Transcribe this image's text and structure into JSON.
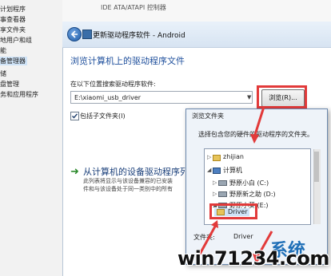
{
  "left_panel": {
    "items": [
      "计划程序",
      "事查看器",
      "享文件夹",
      "地用户和组",
      "能",
      "备管理器",
      "储",
      "盘管理",
      "务和应用程序"
    ],
    "selected_index": 5
  },
  "background": {
    "top_text": "IDE ATA/ATAPI 控制器"
  },
  "wizard": {
    "title": "更新驱动程序软件 - Android",
    "heading": "浏览计算机上的驱动程序文件",
    "search_label": "在以下位置搜索驱动程序软件:",
    "path_value": "E:\\xiaomi_usb_driver",
    "browse_label": "浏览(R)...",
    "include_subfolders_label": "包括子文件夹(I)",
    "include_subfolders_checked": true,
    "pick_link": "从计算机的设备驱动程序列表",
    "pick_desc_line1": "此列表将显示与该设备兼容的已安装",
    "pick_desc_line2": "件和与该设备处于同一类别中的所有"
  },
  "browse_dialog": {
    "title": "浏览文件夹",
    "prompt": "选择包含您的硬件的驱动程序的文件夹。",
    "tree": [
      {
        "label": "zhijian",
        "icon": "folder-icon",
        "toggle": "▷"
      },
      {
        "label": "计算机",
        "icon": "computer-icon",
        "toggle": "◢"
      },
      {
        "label": "野原小白 (C:)",
        "icon": "drive-icon",
        "toggle": "▷"
      },
      {
        "label": "野原新之助 (D:)",
        "icon": "drive-icon",
        "toggle": "▷"
      },
      {
        "label": "野原小葵 (E:)",
        "icon": "drive-icon",
        "toggle": "◢"
      },
      {
        "label": "Driver",
        "icon": "folder-icon",
        "toggle": "▷"
      }
    ],
    "folder_label": "文件夹:",
    "folder_value": "Driver"
  },
  "watermark": {
    "text": "win71234.com",
    "brand": "系统"
  },
  "colors": {
    "highlight_red": "#e23a3a",
    "link_blue": "#1a3f7a",
    "heading_blue": "#1e4f9c"
  }
}
